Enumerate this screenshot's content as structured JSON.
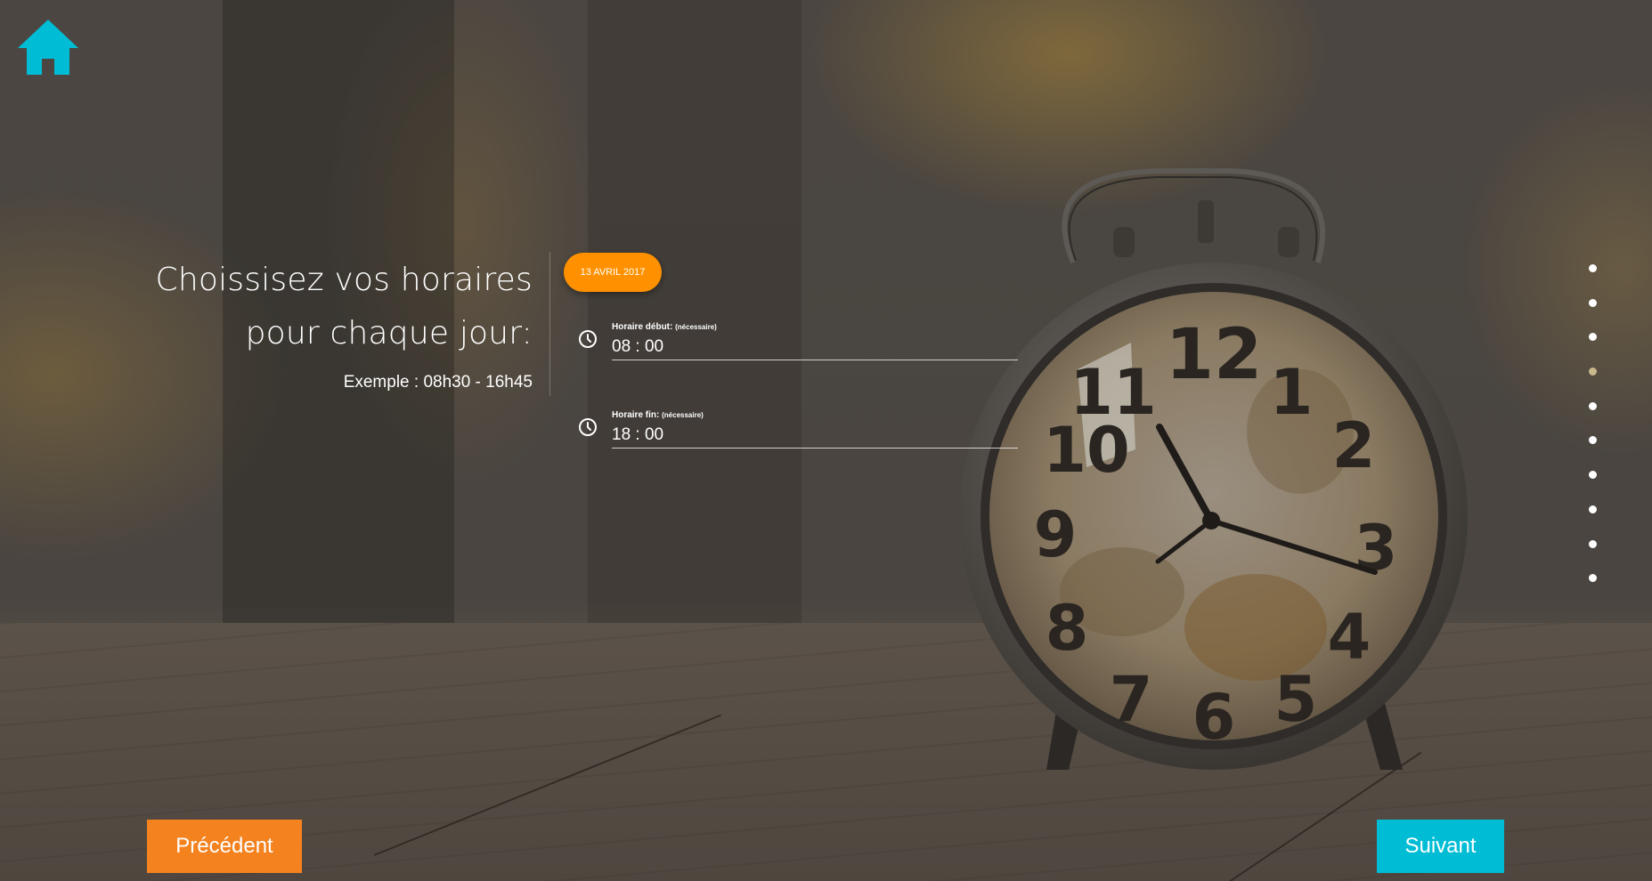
{
  "icons": {
    "home": "home-icon",
    "time": "clock-icon"
  },
  "colors": {
    "accent_orange": "#ff9100",
    "prev_button": "#f3821f",
    "next_button": "#00bcd4",
    "home_icon": "#00bcd4",
    "active_dot": "#c9b88a"
  },
  "heading": {
    "title": "Choissisez vos horaires pour chaque jour:",
    "example": "Exemple : 08h30 - 16h45"
  },
  "date_badge": "13 AVRIL 2017",
  "fields": [
    {
      "label": "Horaire début:",
      "required": "(nécessaire)",
      "value": "08 : 00"
    },
    {
      "label": "Horaire fin:",
      "required": "(nécessaire)",
      "value": "18 : 00"
    }
  ],
  "pagination": {
    "total": 10,
    "active_index": 3
  },
  "buttons": {
    "previous": "Précédent",
    "next": "Suivant"
  }
}
